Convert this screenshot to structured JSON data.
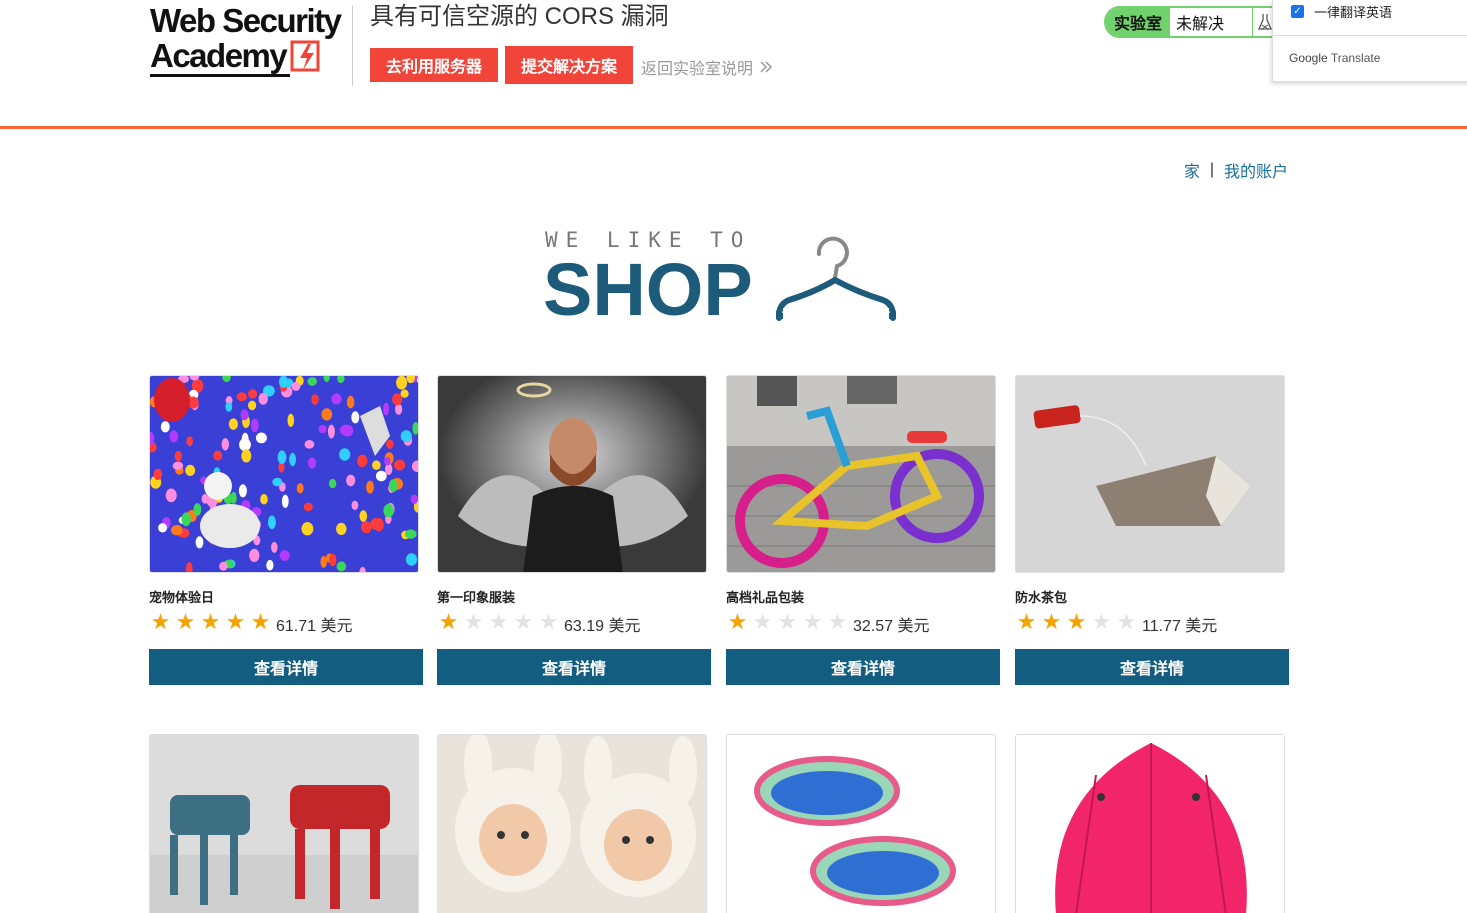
{
  "header": {
    "logo_line1": "Web Security",
    "logo_line2": "Academy",
    "lab_title": "具有可信空源的 CORS 漏洞",
    "exploit_button": "去利用服务器",
    "submit_button": "提交解决方案",
    "back_link": "返回实验室说明",
    "status_label": "实验室",
    "status_value": "未解决"
  },
  "translate_popup": {
    "checkbox_label": "一律翻译英语",
    "checked": true,
    "brand_google": "Google",
    "brand_translate": "Translate"
  },
  "nav": {
    "home": "家",
    "separator": "|",
    "account": "我的账户"
  },
  "hero": {
    "small_text": "WE LIKE TO",
    "big_text": "SHOP"
  },
  "products": [
    {
      "name": "宠物体验日",
      "rating": 5,
      "price": "61.71 美元",
      "button": "查看详情",
      "image": "balloons-dogs-image"
    },
    {
      "name": "第一印象服装",
      "rating": 1,
      "price": "63.19 美元",
      "button": "查看详情",
      "image": "angel-man-image"
    },
    {
      "name": "高档礼品包装",
      "rating": 1,
      "price": "32.57 美元",
      "button": "查看详情",
      "image": "yarn-bicycle-image"
    },
    {
      "name": "防水茶包",
      "rating": 3,
      "price": "11.77 美元",
      "button": "查看详情",
      "image": "teabag-image"
    },
    {
      "name": "",
      "rating": 0,
      "price": "",
      "button": "",
      "image": "robot-spiders-image"
    },
    {
      "name": "",
      "rating": 0,
      "price": "",
      "button": "",
      "image": "bunny-babies-image"
    },
    {
      "name": "",
      "rating": 0,
      "price": "",
      "button": "",
      "image": "paddling-pools-image"
    },
    {
      "name": "",
      "rating": 0,
      "price": "",
      "button": "",
      "image": "pink-umbrella-image"
    }
  ],
  "colors": {
    "accent_red": "#f2453a",
    "banner_line": "#ff6633",
    "lab_green": "#70d16d",
    "primary_blue": "#135e80",
    "star_gold": "#f5a300"
  }
}
